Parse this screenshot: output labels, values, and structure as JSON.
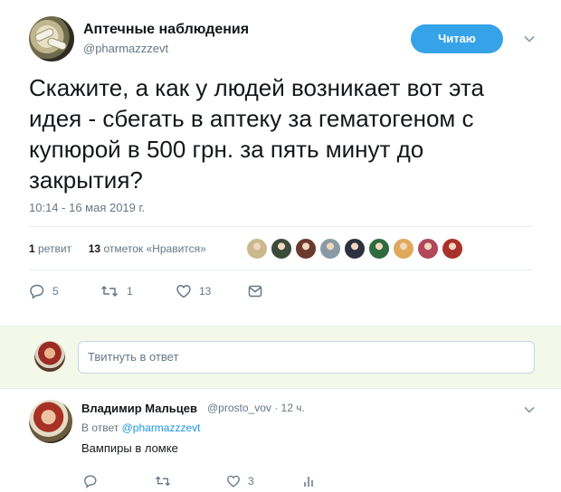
{
  "tweet": {
    "author_name": "Аптечные наблюдения",
    "author_handle": "@pharmazzzevt",
    "follow_label": "Читаю",
    "text": "Скажите, а как у людей возникает вот эта идея - сбегать в аптеку за гематогеном с купюрой в 500 грн. за пять минут до закрытия?",
    "timestamp": "10:14 - 16 мая 2019 г.",
    "retweets_count": "1",
    "retweets_label": "ретвит",
    "likes_count": "13",
    "likes_label": "отметок «Нравится»",
    "likers_colors": [
      "#c9b98d",
      "#3b4a3a",
      "#6b3a2e",
      "#8a9aa5",
      "#2b3140",
      "#2f6b3f",
      "#e0a85b",
      "#b0475a",
      "#a8322b"
    ],
    "actions": {
      "replies": "5",
      "retweets": "1",
      "likes": "13"
    }
  },
  "reply_box": {
    "placeholder": "Твитнуть в ответ"
  },
  "reply": {
    "author_name": "Владимир Мальцев",
    "meta": "@prosto_vov · 12 ч.",
    "in_reply_prefix": "В ответ",
    "in_reply_handle": "@pharmazzzevt",
    "text": "Вампиры в ломке",
    "actions": {
      "likes": "3"
    }
  },
  "colors": {
    "accent": "#36a3e8",
    "reply_bar_bg": "#f4f8e8",
    "muted": "#657786"
  },
  "icons": [
    "reply-icon",
    "retweet-icon",
    "like-icon",
    "dm-icon",
    "analytics-icon",
    "chevron-down-icon"
  ]
}
